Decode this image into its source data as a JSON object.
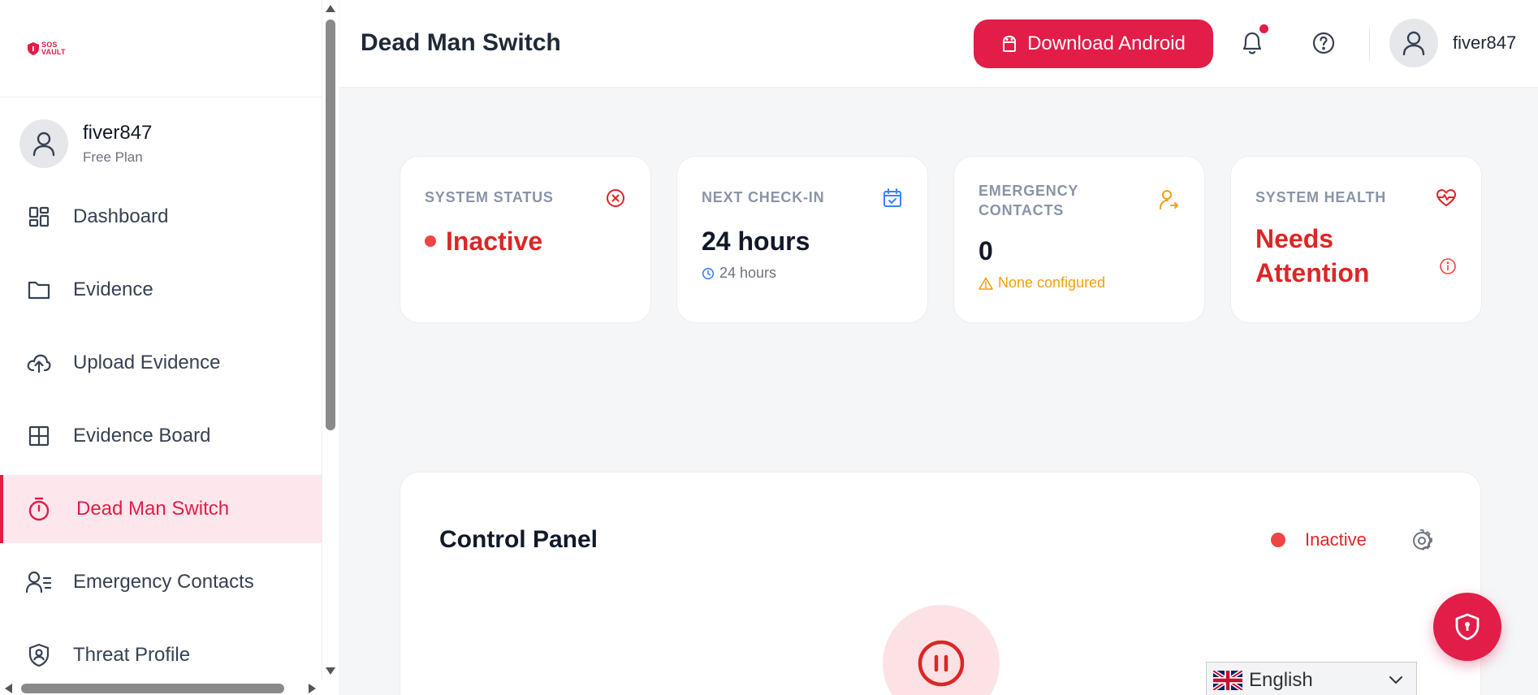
{
  "app": {
    "logo_line1": "SOS",
    "logo_line2": "VAULT"
  },
  "sidebar": {
    "user": {
      "name": "fiver847",
      "plan": "Free Plan"
    },
    "items": [
      {
        "label": "Dashboard",
        "icon": "dashboard-icon"
      },
      {
        "label": "Evidence",
        "icon": "folder-icon"
      },
      {
        "label": "Upload Evidence",
        "icon": "cloud-upload-icon"
      },
      {
        "label": "Evidence Board",
        "icon": "grid-icon"
      },
      {
        "label": "Dead Man Switch",
        "icon": "timer-icon",
        "active": true
      },
      {
        "label": "Emergency Contacts",
        "icon": "contacts-icon"
      },
      {
        "label": "Threat Profile",
        "icon": "shield-user-icon"
      }
    ]
  },
  "header": {
    "title": "Dead Man Switch",
    "download_label": "Download Android",
    "user_name": "fiver847",
    "has_notification": true
  },
  "stats": [
    {
      "label": "SYSTEM STATUS",
      "value": "Inactive",
      "icon": "x-circle-icon",
      "value_color": "#dc2626"
    },
    {
      "label": "NEXT CHECK-IN",
      "value": "24 hours",
      "sub": "24 hours",
      "icon": "calendar-check-icon",
      "value_color": "#111827"
    },
    {
      "label_line1": "EMERGENCY",
      "label_line2": "CONTACTS",
      "value": "0",
      "sub": "None configured",
      "icon": "user-arrow-icon",
      "value_color": "#111827"
    },
    {
      "label": "SYSTEM HEALTH",
      "value_line1": "Needs",
      "value_line2": "Attention",
      "icon": "heart-pulse-icon",
      "value_color": "#dc2626"
    }
  ],
  "control_panel": {
    "title": "Control Panel",
    "status": "Inactive"
  },
  "language": {
    "selected": "English"
  },
  "colors": {
    "accent": "#e11d48",
    "danger": "#dc2626",
    "warning": "#f59e0b",
    "info": "#3b82f6"
  }
}
